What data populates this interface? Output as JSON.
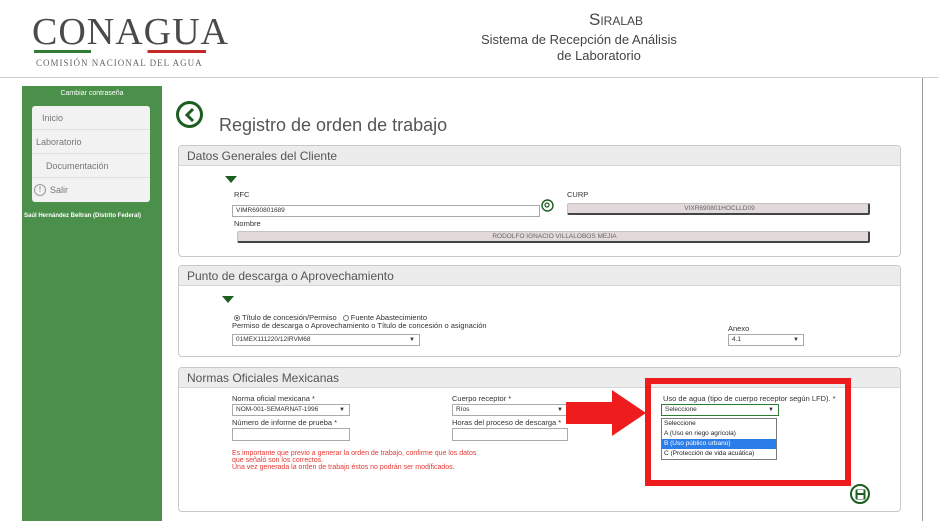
{
  "header": {
    "logo": "CONAGUA",
    "logo_sub": "COMISIÓN NACIONAL DEL AGUA",
    "app_name": "Siralab",
    "app_sub_line1": "Sistema de Recepción de Análisis",
    "app_sub_line2": "de Laboratorio"
  },
  "sidebar": {
    "change_password": "Cambiar contraseña",
    "items": [
      {
        "label": "Inicio"
      },
      {
        "label": "Laboratorio"
      },
      {
        "label": "Documentación"
      },
      {
        "label": "Salir"
      }
    ],
    "user": "Saúl Hernández Beltran (Distrito Federal)"
  },
  "page": {
    "title": "Registro de orden de trabajo"
  },
  "datos_cliente": {
    "heading": "Datos Generales del Cliente",
    "rfc_label": "RFC",
    "rfc_value": "VIMR690801689",
    "curp_label": "CURP",
    "curp_value": "VIXR690801HOCLLD09",
    "nombre_label": "Nombre",
    "nombre_value": "RODOLFO IGNACIO VILLALOBOS MEJIA"
  },
  "punto_descarga": {
    "heading": "Punto de descarga o Aprovechamiento",
    "radio_titulo": "Título de concesión/Permiso",
    "radio_fuente": "Fuente Abastecimiento",
    "permiso_label": "Permiso de descarga o Aprovechamiento o Título de concesión o asignación",
    "permiso_value": "01MEX111220/12IRVM68",
    "anexo_label": "Anexo",
    "anexo_value": "4.1"
  },
  "normas": {
    "heading": "Normas Oficiales Mexicanas",
    "norma_label": "Norma oficial mexicana *",
    "norma_value": "NOM-001-SEMARNAT-1996",
    "cuerpo_label": "Cuerpo receptor *",
    "cuerpo_value": "Ríos",
    "uso_label": "Uso de agua (tipo de cuerpo receptor según LFD). *",
    "uso_value": "Seleccione",
    "uso_options": [
      "Seleccione",
      "A (Uso en riego agrícola)",
      "B (Uso público urbano)",
      "C (Protección de vida acuática)"
    ],
    "uso_selected_index": 2,
    "informe_label": "Número de informe de prueba *",
    "horas_label": "Horas del proceso de descarga *",
    "warning_line1": "Es importante que previo a generar la orden de trabajo, confirme que los datos",
    "warning_line2": " que señaló son los correctos.",
    "warning_line3": "Una vez generada la orden de trabajo éstos no podrán ser modificados."
  },
  "colors": {
    "sidebar_green": "#4a8f4a",
    "icon_green": "#1b5e20",
    "highlight_red": "#ee1c1c",
    "warning_red": "#e53935",
    "selected_blue": "#2b7de9"
  }
}
